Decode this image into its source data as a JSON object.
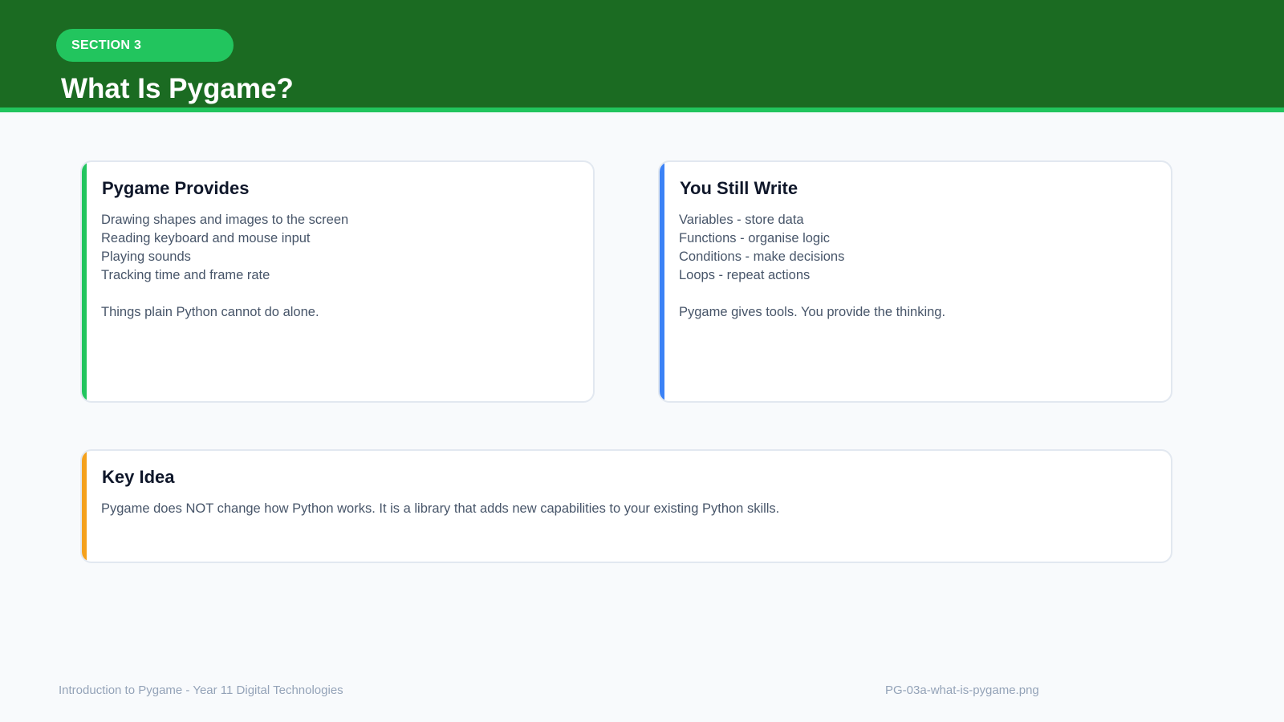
{
  "header": {
    "section_label": "SECTION 3",
    "title": "What Is Pygame?"
  },
  "cards": {
    "left": {
      "title": "Pygame Provides",
      "items": [
        "Drawing shapes and images to the screen",
        "Reading keyboard and mouse input",
        "Playing sounds",
        "Tracking time and frame rate"
      ],
      "note": "Things plain Python cannot do alone."
    },
    "right": {
      "title": "You Still Write",
      "items": [
        "Variables - store data",
        "Functions - organise logic",
        "Conditions - make decisions",
        "Loops - repeat actions"
      ],
      "note": "Pygame gives tools. You provide the thinking."
    },
    "key": {
      "title": "Key Idea",
      "text": "Pygame does NOT change how Python works. It is a library that adds new capabilities to your existing Python skills."
    }
  },
  "footer": {
    "course": "Introduction to Pygame - Year 11 Digital Technologies",
    "filename": "PG-03a-what-is-pygame.png"
  },
  "colors": {
    "header_bg": "#1b6b22",
    "header_stripe": "#22c55e",
    "pill_bg": "#22c55e",
    "accent_green": "#22c55e",
    "accent_blue": "#3b82f6",
    "accent_orange": "#f5a11c",
    "page_bg": "#f8fafc"
  }
}
